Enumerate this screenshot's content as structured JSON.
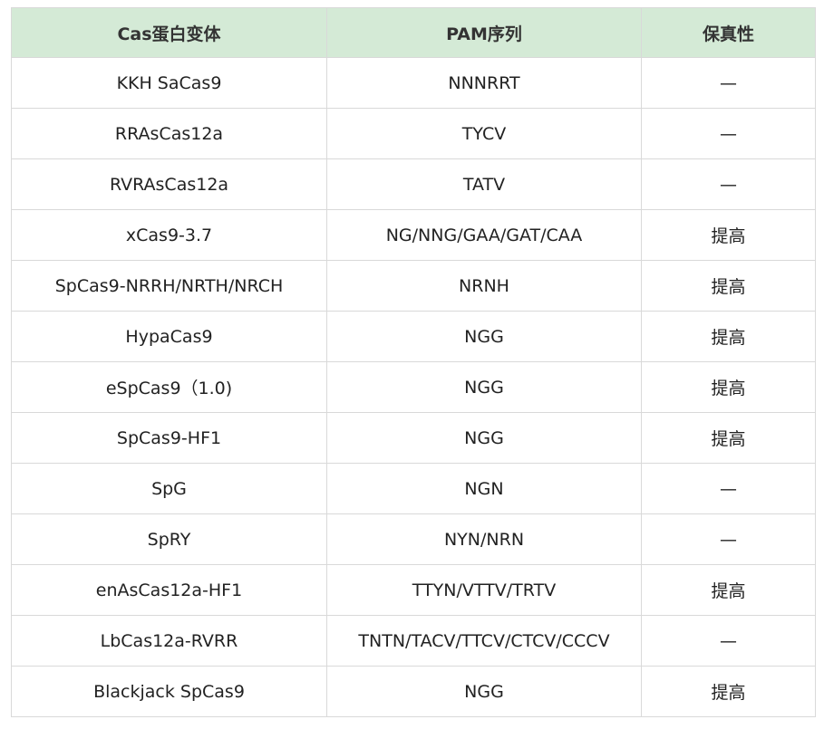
{
  "table": {
    "headers": [
      "Cas蛋白变体",
      "PAM序列",
      "保真性"
    ],
    "rows": [
      [
        "KKH SaCas9",
        "NNNRRT",
        "—"
      ],
      [
        "RRAsCas12a",
        "TYCV",
        "—"
      ],
      [
        "RVRAsCas12a",
        "TATV",
        "—"
      ],
      [
        "xCas9-3.7",
        "NG/NNG/GAA/GAT/CAA",
        "提高"
      ],
      [
        "SpCas9-NRRH/NRTH/NRCH",
        "NRNH",
        "提高"
      ],
      [
        "HypaCas9",
        "NGG",
        "提高"
      ],
      [
        "eSpCas9（1.0)",
        "NGG",
        "提高"
      ],
      [
        "SpCas9-HF1",
        "NGG",
        "提高"
      ],
      [
        "SpG",
        "NGN",
        "—"
      ],
      [
        "SpRY",
        "NYN/NRN",
        "—"
      ],
      [
        "enAsCas12a-HF1",
        "TTYN/VTTV/TRTV",
        "提高"
      ],
      [
        "LbCas12a-RVRR",
        "TNTN/TACV/TTCV/CTCV/CCCV",
        "—"
      ],
      [
        "Blackjack SpCas9",
        "NGG",
        "提高"
      ]
    ]
  },
  "colors": {
    "header_bg": "#d4ead6",
    "border": "#d9d9d9"
  }
}
